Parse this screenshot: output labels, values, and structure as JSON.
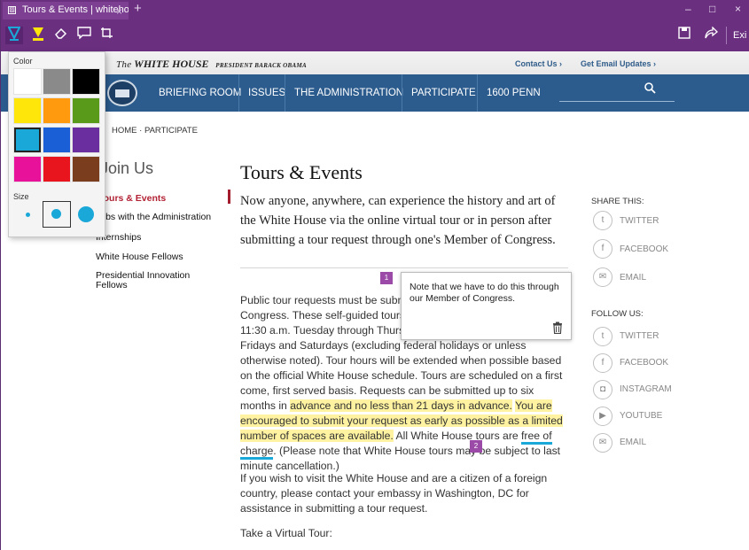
{
  "browser": {
    "tab_title": "Tours & Events | whiteho",
    "tab_close": "×",
    "new_tab": "+",
    "win_min": "–",
    "win_max": "□",
    "win_close": "×",
    "exit_label": "Exi"
  },
  "toolbar": {
    "icons": [
      "pen-icon",
      "highlighter-icon",
      "eraser-icon",
      "comment-icon",
      "clip-icon"
    ],
    "right_icons": [
      "save-icon",
      "share-icon"
    ]
  },
  "color_panel": {
    "color_label": "Color",
    "size_label": "Size",
    "swatches": [
      "#ffffff",
      "#8a8a8a",
      "#000000",
      "#ffe60a",
      "#ff9a0f",
      "#5a9a1a",
      "#1aa8d8",
      "#1a5fd6",
      "#6a2e9e",
      "#e8129a",
      "#e8141e",
      "#7a3e1e"
    ],
    "selected_swatch": "#1aa8d8",
    "sizes": [
      "small",
      "medium",
      "large"
    ],
    "selected_size": "medium"
  },
  "site": {
    "brand_the": "The",
    "brand_name": "WHITE HOUSE",
    "brand_sub": "PRESIDENT BARACK OBAMA",
    "contact": "Contact Us ›",
    "email_updates": "Get Email Updates ›",
    "nav": [
      "BRIEFING ROOM",
      "ISSUES",
      "THE ADMINISTRATION",
      "PARTICIPATE",
      "1600 PENN"
    ],
    "search_icon": "search-icon",
    "breadcrumb": "HOME · PARTICIPATE",
    "side_heading": "Join Us",
    "side_links": [
      "Tours & Events",
      "Jobs with the Administration",
      "Internships",
      "White House Fellows",
      "Presidential Innovation Fellows"
    ]
  },
  "article": {
    "title": "Tours & Events",
    "lead": "Now anyone, anywhere, can experience the history and art of the White House via the online virtual tour or in person after submitting a tour request through one's Member of Congress.",
    "p1_start": "Public tour requests must be submitted through one's Member of Congress.  These self-guided tours are available from 7:30 a.m. to 11:30 a.m. Tuesday through Thursday, 7:30 a.m. to 1:30 p.m. Fridays and Saturdays (excluding federal holidays or unless otherwise noted).  Tour hours will be extended when possible based on the official White House schedule. Tours are scheduled on a first come, first served basis. Requests can be submitted up to six months in ",
    "p1_hl1": "advance and no less than 21 days in advance.",
    "p1_mid": " ",
    "p1_hl2": "You are encouraged to submit your request as early as possible as a limited number of spaces are available.",
    "p1_after": " All White House tours are ",
    "p1_underline": "free of charge",
    "p1_end": ". (Please note that White House tours may be subject to last minute cancellation.)",
    "p2": "If you wish to visit the White House and are a citizen of a foreign country, please contact your embassy in Washington, DC for assistance in submitting a tour request.",
    "p3": "Take a Virtual Tour:"
  },
  "share": {
    "share_heading": "SHARE THIS:",
    "share_items": [
      "TWITTER",
      "FACEBOOK",
      "EMAIL"
    ],
    "follow_heading": "FOLLOW US:",
    "follow_items": [
      "TWITTER",
      "FACEBOOK",
      "INSTAGRAM",
      "YOUTUBE",
      "EMAIL"
    ]
  },
  "annotations": {
    "pin1": "1",
    "pin2": "2",
    "note_text": "Note that we have to do this through our Member of Congress.",
    "trash_icon": "trash-icon"
  }
}
